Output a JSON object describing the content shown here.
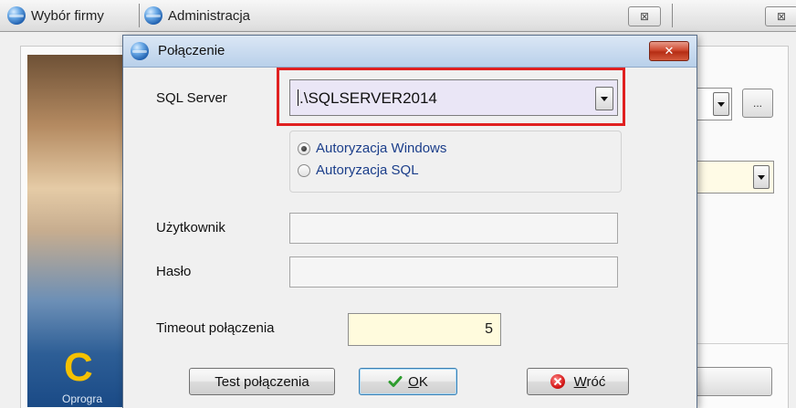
{
  "tabs": [
    {
      "label": "Wybór firmy"
    },
    {
      "label": "Administracja"
    }
  ],
  "tab_close_glyph": "⊠",
  "background": {
    "logo_text": "C",
    "tagline": "Oprogra",
    "ellipsis_label": "..."
  },
  "dialog": {
    "title": "Połączenie",
    "close_glyph": "✕",
    "sql_server_label": "SQL  Server",
    "sql_server_value": ".\\SQLSERVER2014",
    "auth_options": [
      {
        "label": "Autoryzacja  Windows",
        "checked": true
      },
      {
        "label": "Autoryzacja  SQL",
        "checked": false
      }
    ],
    "user_label": "Użytkownik",
    "user_value": "",
    "password_label": "Hasło",
    "password_value": "",
    "timeout_label": "Timeout połączenia",
    "timeout_value": "5",
    "buttons": {
      "test": "Test połączenia",
      "ok_accel": "O",
      "ok_rest": "K",
      "back_accel": "W",
      "back_rest": "róć"
    }
  },
  "colors": {
    "highlight": "#e02020",
    "combo_bg": "#eae6f6",
    "timeout_bg": "#fffbdd",
    "radio_text": "#1b3e8a"
  }
}
